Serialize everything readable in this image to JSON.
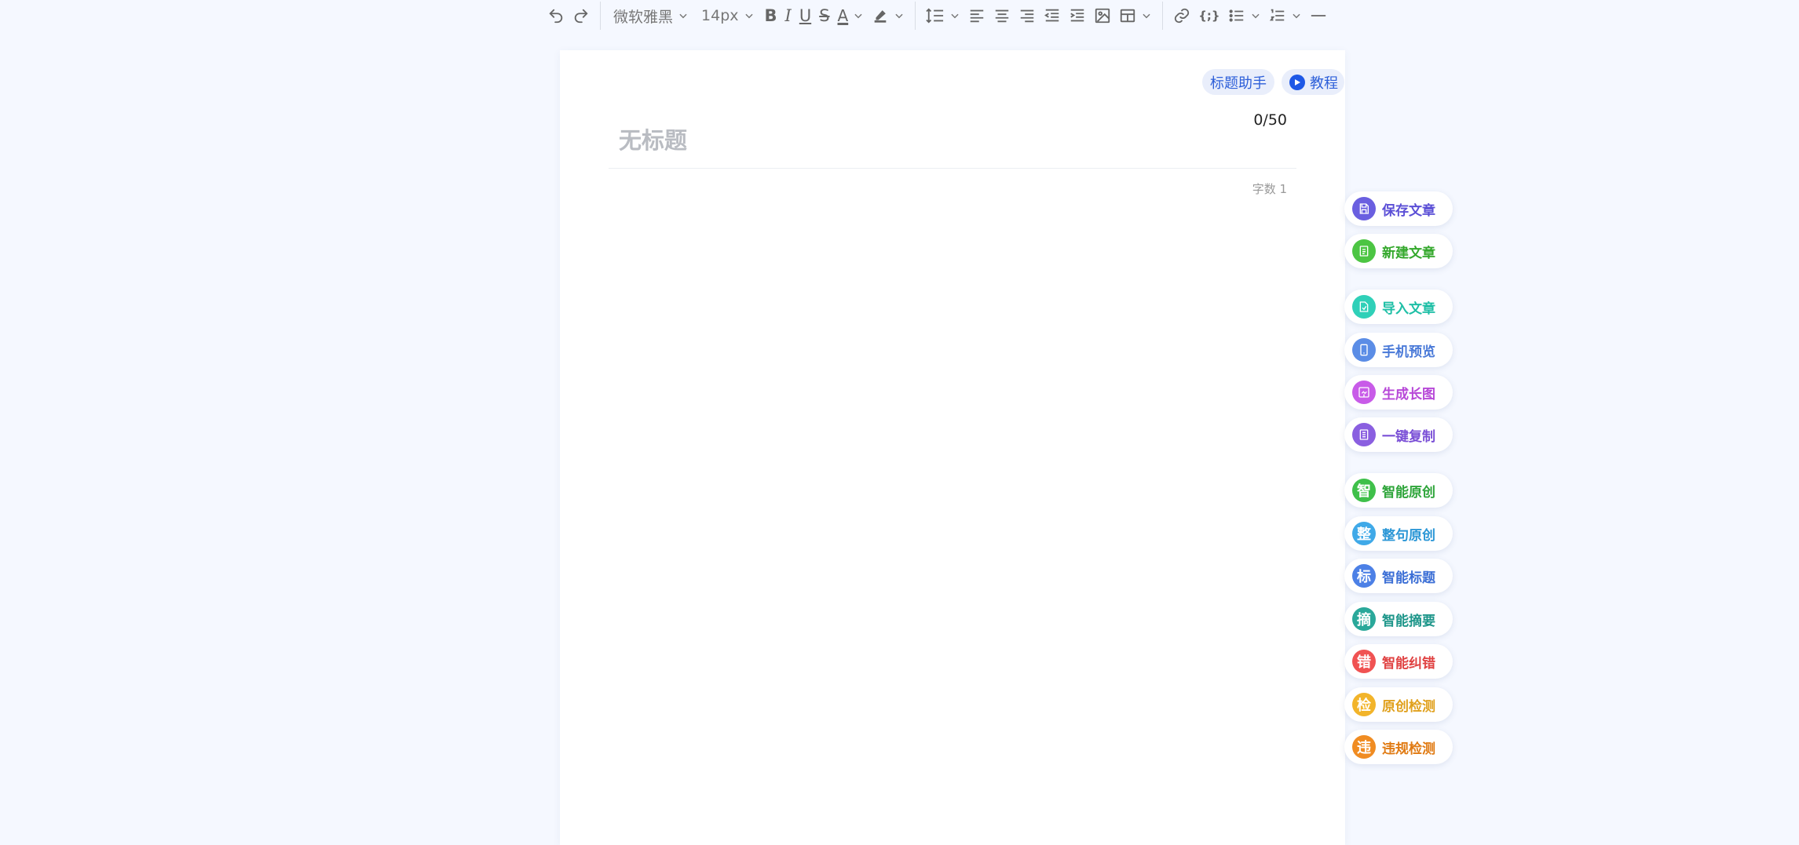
{
  "toolbar": {
    "font_family": "微软雅黑",
    "font_size": "14px",
    "bold_label": "B",
    "italic_label": "I",
    "underline_label": "U",
    "strike_label": "S",
    "font_color_label": "A",
    "code_label": "{;}"
  },
  "editor": {
    "title_placeholder": "无标题",
    "title_count": "0/50",
    "word_count": "字数 1",
    "helper_label": "标题助手",
    "tutorial_label": "教程"
  },
  "actions": [
    {
      "id": "save-article",
      "label": "保存文章",
      "icon": "save-icon",
      "glyph": "",
      "color": "#6a5fe0",
      "text_color": "#5b4fd6"
    },
    {
      "id": "new-article",
      "label": "新建文章",
      "icon": "new-doc-icon",
      "glyph": "",
      "color": "#4cc543",
      "text_color": "#34a82c"
    },
    {
      "id": "import-article",
      "label": "导入文章",
      "icon": "import-icon",
      "glyph": "",
      "color": "#2fd0b8",
      "text_color": "#1ebfa6"
    },
    {
      "id": "mobile-preview",
      "label": "手机预览",
      "icon": "phone-icon",
      "glyph": "",
      "color": "#5b8de6",
      "text_color": "#4a7ad8"
    },
    {
      "id": "long-image",
      "label": "生成长图",
      "icon": "image-icon",
      "glyph": "",
      "color": "#c85be8",
      "text_color": "#b748d8"
    },
    {
      "id": "copy-all",
      "label": "一键复制",
      "icon": "copy-icon",
      "glyph": "",
      "color": "#8a5fe0",
      "text_color": "#7a4fd6"
    },
    {
      "id": "smart-original",
      "label": "智能原创",
      "icon": "zhi-icon",
      "glyph": "智",
      "color": "#3fc04a",
      "text_color": "#2ea53a"
    },
    {
      "id": "sentence-original",
      "label": "整句原创",
      "icon": "zheng-icon",
      "glyph": "整",
      "color": "#3fa9e8",
      "text_color": "#2a96d6"
    },
    {
      "id": "smart-title",
      "label": "智能标题",
      "icon": "biao-icon",
      "glyph": "标",
      "color": "#4c80e6",
      "text_color": "#3c6fd6"
    },
    {
      "id": "smart-summary",
      "label": "智能摘要",
      "icon": "zhai-icon",
      "glyph": "摘",
      "color": "#2aa89a",
      "text_color": "#1e968a"
    },
    {
      "id": "smart-correct",
      "label": "智能纠错",
      "icon": "cuo-icon",
      "glyph": "错",
      "color": "#f05252",
      "text_color": "#e04343"
    },
    {
      "id": "originality-check",
      "label": "原创检测",
      "icon": "jian-icon",
      "glyph": "检",
      "color": "#f2b42a",
      "text_color": "#e0a01c"
    },
    {
      "id": "violation-check",
      "label": "违规检测",
      "icon": "wei-icon",
      "glyph": "违",
      "color": "#f08c22",
      "text_color": "#e07a12"
    }
  ]
}
